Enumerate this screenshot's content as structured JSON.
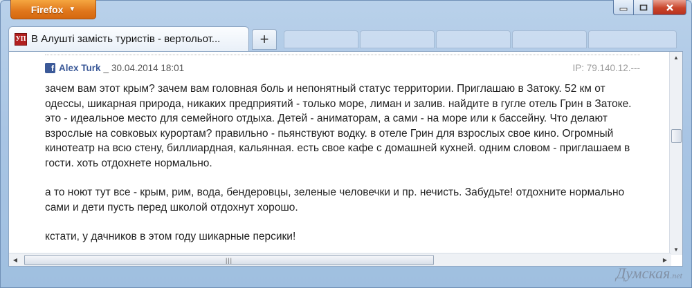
{
  "browser": {
    "app_button_label": "Firefox",
    "tab_title": "В Алушті замість туристів - вертольот...",
    "favicon_text": "УП",
    "new_tab_label": "+"
  },
  "comment": {
    "author": "Alex Turk",
    "separator": "_",
    "date": "30.04.2014 18:01",
    "ip": "IP: 79.140.12.---",
    "paragraphs": [
      "зачем вам этот крым? зачем вам головная боль и непонятный статус территории. Приглашаю в Затоку. 52 км от одессы, шикарная природа, никаких предприятий - только море, лиман и залив. найдите в гугле отель Грин в Затоке. это - идеальное место для семейного отдыха. Детей - аниматорам, а сами - на море или к бассейну. Что делают взрослые на совковых курортам? правильно - пьянствуют водку. в отеле Грин для взрослых свое кино. Огромный кинотеатр на всю стену, биллиардная, кальянная. есть свое кафе с домашней кухней. одним словом - приглашаем в гости. хоть отдохнете нормально.",
      "а то ноют тут все - крым, рим, вода, бендеровцы, зеленые человечки и пр. нечисть. Забудьте! отдохните нормально сами и дети пусть перед школой отдохнут хорошо.",
      "кстати, у дачников в этом году шикарные персики!"
    ]
  },
  "watermark": {
    "text": "Думская",
    "suffix": ".net"
  }
}
